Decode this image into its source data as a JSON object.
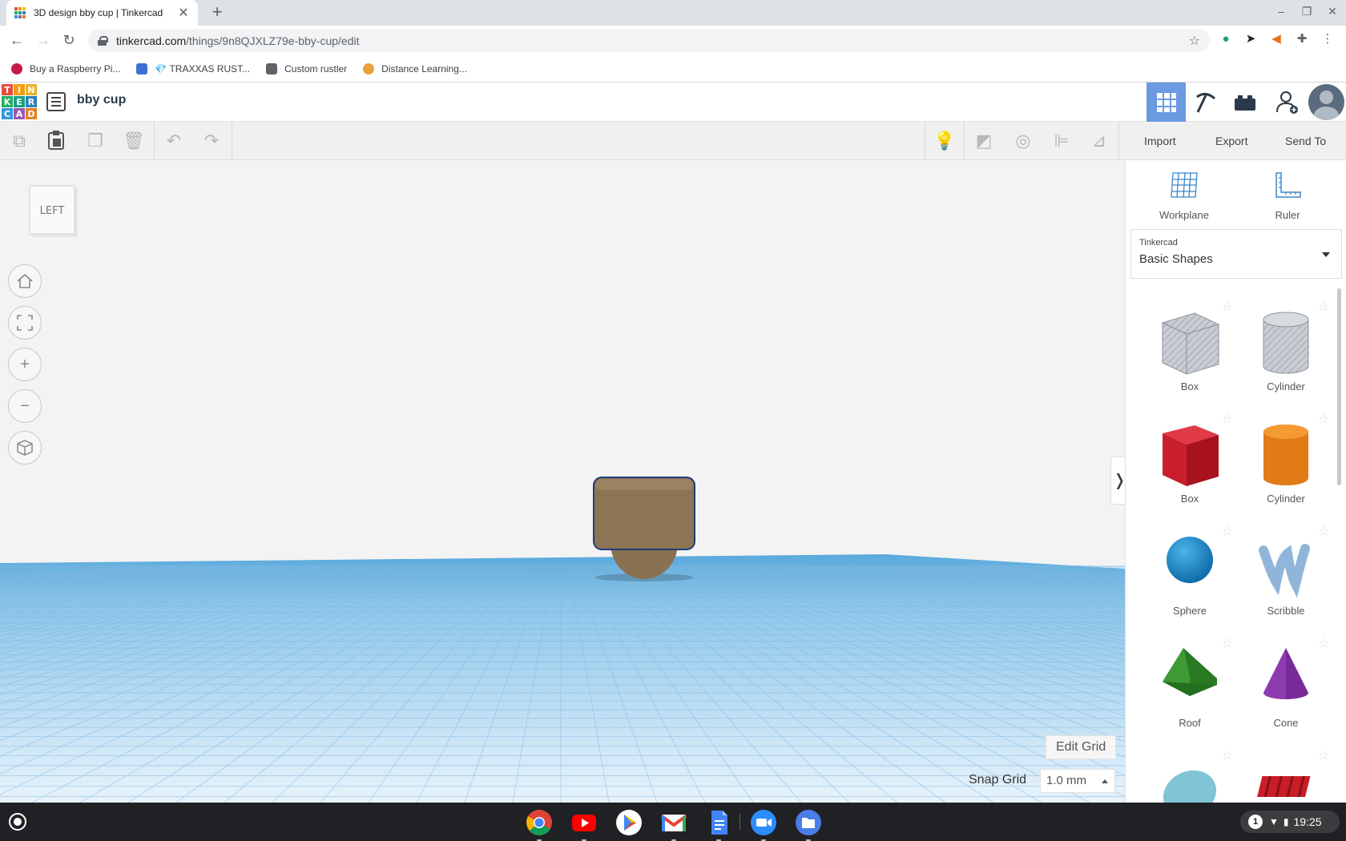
{
  "browser": {
    "tab_title": "3D design bby cup | Tinkercad",
    "url_host": "tinkercad.com",
    "url_path": "/things/9n8QJXLZ79e-bby-cup/edit",
    "bookmarks": [
      {
        "label": "Buy a Raspberry Pi...",
        "color": "#c51a4a"
      },
      {
        "label": "💎 TRAXXAS RUST...",
        "color": "#3b6fd4"
      },
      {
        "label": "Custom rustler",
        "color": "#5f6368"
      },
      {
        "label": "Distance Learning...",
        "color": "#e8a33d"
      }
    ]
  },
  "app": {
    "logo_letters": [
      "T",
      "I",
      "N",
      "K",
      "E",
      "R",
      "C",
      "A",
      "D"
    ],
    "logo_colors": [
      "#e74c3c",
      "#f39c12",
      "#f1c40f",
      "#27ae60",
      "#16a085",
      "#2980b9",
      "#3498db",
      "#9b59b6",
      "#e67e22"
    ],
    "design_name": "bby cup",
    "accent_color": "#6b9ae0"
  },
  "toolbar": {
    "import_label": "Import",
    "export_label": "Export",
    "send_to_label": "Send To"
  },
  "workspace": {
    "viewcube_label": "LEFT",
    "edit_grid_label": "Edit Grid",
    "snap_grid_label": "Snap Grid",
    "snap_grid_value": "1.0 mm",
    "object_color": "#8a7152"
  },
  "panel": {
    "workplane_label": "Workplane",
    "ruler_label": "Ruler",
    "library_owner": "Tinkercad",
    "library_name": "Basic Shapes",
    "shapes": [
      {
        "label": "Box",
        "kind": "box-hole"
      },
      {
        "label": "Cylinder",
        "kind": "cyl-hole"
      },
      {
        "label": "Box",
        "kind": "box"
      },
      {
        "label": "Cylinder",
        "kind": "cyl"
      },
      {
        "label": "Sphere",
        "kind": "sphere"
      },
      {
        "label": "Scribble",
        "kind": "scribble"
      },
      {
        "label": "Roof",
        "kind": "roof"
      },
      {
        "label": "Cone",
        "kind": "cone"
      }
    ]
  },
  "shelf": {
    "notification_count": "1",
    "time": "19:25"
  }
}
